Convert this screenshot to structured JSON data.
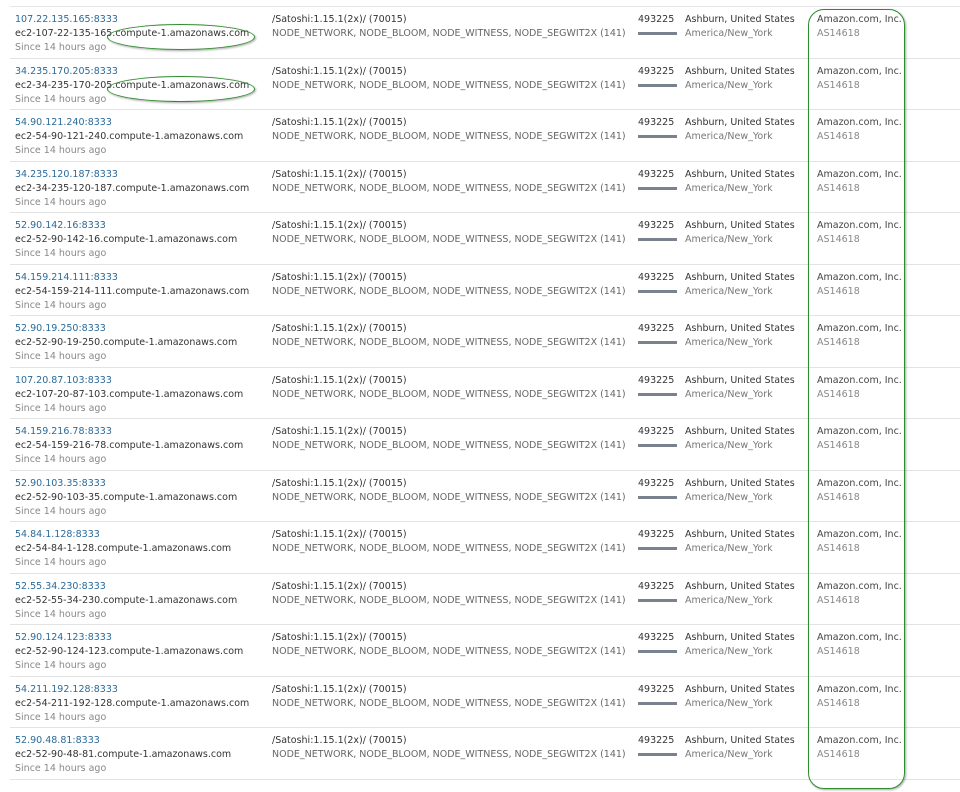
{
  "nodes": [
    {
      "address": "107.22.135.165:8333",
      "host": "ec2-107-22-135-165.compute-1.amazonaws.com",
      "since": "Since 14 hours ago",
      "agent": "/Satoshi:1.15.1(2x)/ (70015)",
      "services": "NODE_NETWORK, NODE_BLOOM, NODE_WITNESS, NODE_SEGWIT2X (141)",
      "height": "493225",
      "location": "Ashburn, United States",
      "timezone": "America/New_York",
      "org": "Amazon.com, Inc.",
      "asn": "AS14618"
    },
    {
      "address": "34.235.170.205:8333",
      "host": "ec2-34-235-170-205.compute-1.amazonaws.com",
      "since": "Since 14 hours ago",
      "agent": "/Satoshi:1.15.1(2x)/ (70015)",
      "services": "NODE_NETWORK, NODE_BLOOM, NODE_WITNESS, NODE_SEGWIT2X (141)",
      "height": "493225",
      "location": "Ashburn, United States",
      "timezone": "America/New_York",
      "org": "Amazon.com, Inc.",
      "asn": "AS14618"
    },
    {
      "address": "54.90.121.240:8333",
      "host": "ec2-54-90-121-240.compute-1.amazonaws.com",
      "since": "Since 14 hours ago",
      "agent": "/Satoshi:1.15.1(2x)/ (70015)",
      "services": "NODE_NETWORK, NODE_BLOOM, NODE_WITNESS, NODE_SEGWIT2X (141)",
      "height": "493225",
      "location": "Ashburn, United States",
      "timezone": "America/New_York",
      "org": "Amazon.com, Inc.",
      "asn": "AS14618"
    },
    {
      "address": "34.235.120.187:8333",
      "host": "ec2-34-235-120-187.compute-1.amazonaws.com",
      "since": "Since 14 hours ago",
      "agent": "/Satoshi:1.15.1(2x)/ (70015)",
      "services": "NODE_NETWORK, NODE_BLOOM, NODE_WITNESS, NODE_SEGWIT2X (141)",
      "height": "493225",
      "location": "Ashburn, United States",
      "timezone": "America/New_York",
      "org": "Amazon.com, Inc.",
      "asn": "AS14618"
    },
    {
      "address": "52.90.142.16:8333",
      "host": "ec2-52-90-142-16.compute-1.amazonaws.com",
      "since": "Since 14 hours ago",
      "agent": "/Satoshi:1.15.1(2x)/ (70015)",
      "services": "NODE_NETWORK, NODE_BLOOM, NODE_WITNESS, NODE_SEGWIT2X (141)",
      "height": "493225",
      "location": "Ashburn, United States",
      "timezone": "America/New_York",
      "org": "Amazon.com, Inc.",
      "asn": "AS14618"
    },
    {
      "address": "54.159.214.111:8333",
      "host": "ec2-54-159-214-111.compute-1.amazonaws.com",
      "since": "Since 14 hours ago",
      "agent": "/Satoshi:1.15.1(2x)/ (70015)",
      "services": "NODE_NETWORK, NODE_BLOOM, NODE_WITNESS, NODE_SEGWIT2X (141)",
      "height": "493225",
      "location": "Ashburn, United States",
      "timezone": "America/New_York",
      "org": "Amazon.com, Inc.",
      "asn": "AS14618"
    },
    {
      "address": "52.90.19.250:8333",
      "host": "ec2-52-90-19-250.compute-1.amazonaws.com",
      "since": "Since 14 hours ago",
      "agent": "/Satoshi:1.15.1(2x)/ (70015)",
      "services": "NODE_NETWORK, NODE_BLOOM, NODE_WITNESS, NODE_SEGWIT2X (141)",
      "height": "493225",
      "location": "Ashburn, United States",
      "timezone": "America/New_York",
      "org": "Amazon.com, Inc.",
      "asn": "AS14618"
    },
    {
      "address": "107.20.87.103:8333",
      "host": "ec2-107-20-87-103.compute-1.amazonaws.com",
      "since": "Since 14 hours ago",
      "agent": "/Satoshi:1.15.1(2x)/ (70015)",
      "services": "NODE_NETWORK, NODE_BLOOM, NODE_WITNESS, NODE_SEGWIT2X (141)",
      "height": "493225",
      "location": "Ashburn, United States",
      "timezone": "America/New_York",
      "org": "Amazon.com, Inc.",
      "asn": "AS14618"
    },
    {
      "address": "54.159.216.78:8333",
      "host": "ec2-54-159-216-78.compute-1.amazonaws.com",
      "since": "Since 14 hours ago",
      "agent": "/Satoshi:1.15.1(2x)/ (70015)",
      "services": "NODE_NETWORK, NODE_BLOOM, NODE_WITNESS, NODE_SEGWIT2X (141)",
      "height": "493225",
      "location": "Ashburn, United States",
      "timezone": "America/New_York",
      "org": "Amazon.com, Inc.",
      "asn": "AS14618"
    },
    {
      "address": "52.90.103.35:8333",
      "host": "ec2-52-90-103-35.compute-1.amazonaws.com",
      "since": "Since 14 hours ago",
      "agent": "/Satoshi:1.15.1(2x)/ (70015)",
      "services": "NODE_NETWORK, NODE_BLOOM, NODE_WITNESS, NODE_SEGWIT2X (141)",
      "height": "493225",
      "location": "Ashburn, United States",
      "timezone": "America/New_York",
      "org": "Amazon.com, Inc.",
      "asn": "AS14618"
    },
    {
      "address": "54.84.1.128:8333",
      "host": "ec2-54-84-1-128.compute-1.amazonaws.com",
      "since": "Since 14 hours ago",
      "agent": "/Satoshi:1.15.1(2x)/ (70015)",
      "services": "NODE_NETWORK, NODE_BLOOM, NODE_WITNESS, NODE_SEGWIT2X (141)",
      "height": "493225",
      "location": "Ashburn, United States",
      "timezone": "America/New_York",
      "org": "Amazon.com, Inc.",
      "asn": "AS14618"
    },
    {
      "address": "52.55.34.230:8333",
      "host": "ec2-52-55-34-230.compute-1.amazonaws.com",
      "since": "Since 14 hours ago",
      "agent": "/Satoshi:1.15.1(2x)/ (70015)",
      "services": "NODE_NETWORK, NODE_BLOOM, NODE_WITNESS, NODE_SEGWIT2X (141)",
      "height": "493225",
      "location": "Ashburn, United States",
      "timezone": "America/New_York",
      "org": "Amazon.com, Inc.",
      "asn": "AS14618"
    },
    {
      "address": "52.90.124.123:8333",
      "host": "ec2-52-90-124-123.compute-1.amazonaws.com",
      "since": "Since 14 hours ago",
      "agent": "/Satoshi:1.15.1(2x)/ (70015)",
      "services": "NODE_NETWORK, NODE_BLOOM, NODE_WITNESS, NODE_SEGWIT2X (141)",
      "height": "493225",
      "location": "Ashburn, United States",
      "timezone": "America/New_York",
      "org": "Amazon.com, Inc.",
      "asn": "AS14618"
    },
    {
      "address": "54.211.192.128:8333",
      "host": "ec2-54-211-192-128.compute-1.amazonaws.com",
      "since": "Since 14 hours ago",
      "agent": "/Satoshi:1.15.1(2x)/ (70015)",
      "services": "NODE_NETWORK, NODE_BLOOM, NODE_WITNESS, NODE_SEGWIT2X (141)",
      "height": "493225",
      "location": "Ashburn, United States",
      "timezone": "America/New_York",
      "org": "Amazon.com, Inc.",
      "asn": "AS14618"
    },
    {
      "address": "52.90.48.81:8333",
      "host": "ec2-52-90-48-81.compute-1.amazonaws.com",
      "since": "Since 14 hours ago",
      "agent": "/Satoshi:1.15.1(2x)/ (70015)",
      "services": "NODE_NETWORK, NODE_BLOOM, NODE_WITNESS, NODE_SEGWIT2X (141)",
      "height": "493225",
      "location": "Ashburn, United States",
      "timezone": "America/New_York",
      "org": "Amazon.com, Inc.",
      "asn": "AS14618"
    }
  ],
  "colors": {
    "link": "#2b6a99",
    "annotation": "#2e8b2e",
    "row_border": "#e3e3e3",
    "bar": "#7a8290"
  }
}
